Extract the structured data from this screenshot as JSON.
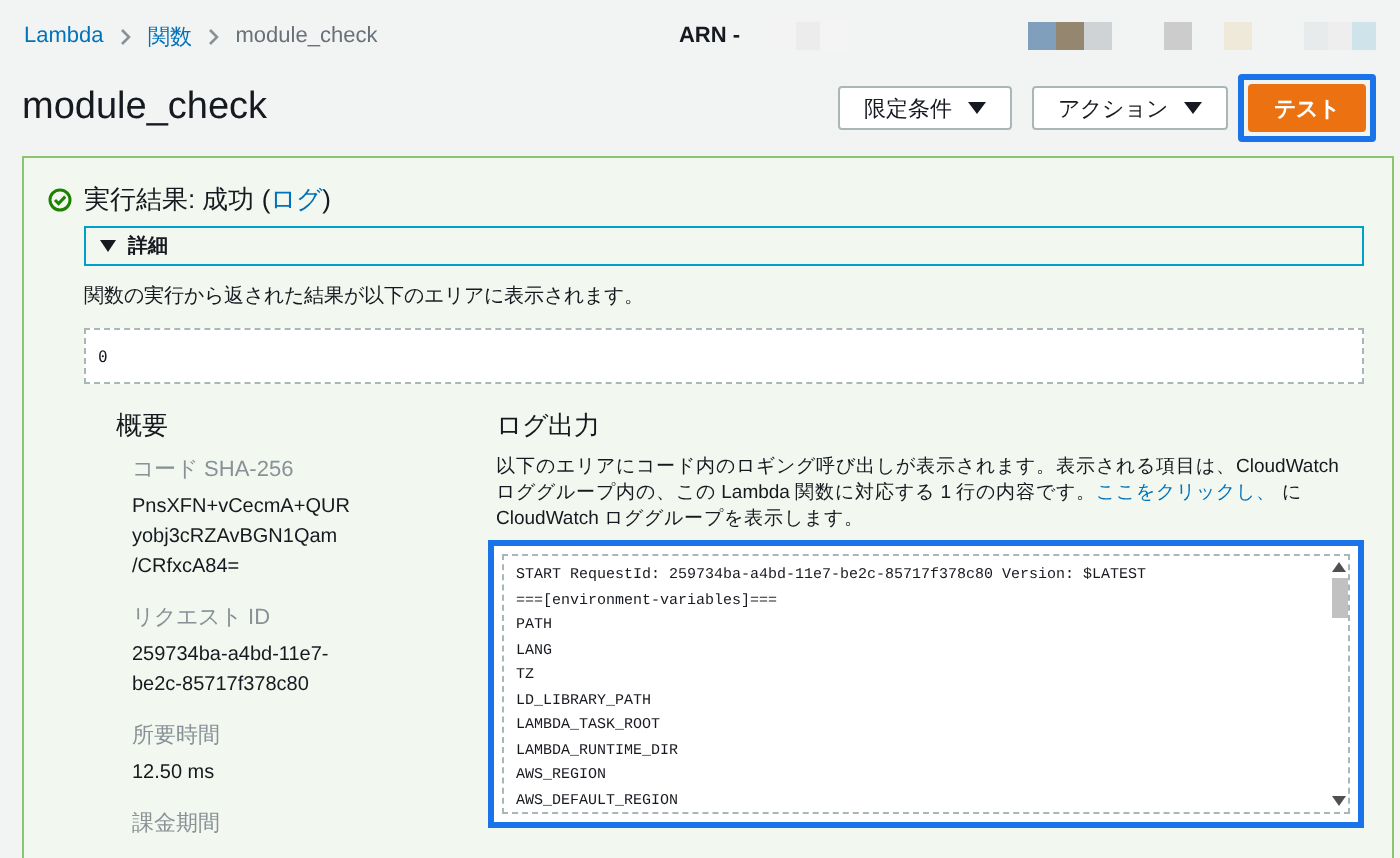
{
  "breadcrumb": [
    {
      "label": "Lambda",
      "link": true
    },
    {
      "label": "関数",
      "link": true
    },
    {
      "label": "module_check",
      "link": false
    }
  ],
  "arn": {
    "label": "ARN -"
  },
  "title": "module_check",
  "actions": [
    {
      "label": "限定条件",
      "kind": "dropdown",
      "highlighted": false
    },
    {
      "label": "アクション",
      "kind": "dropdown",
      "highlighted": false
    },
    {
      "label": "テスト",
      "kind": "primary",
      "highlighted": true
    }
  ],
  "result": {
    "succeeded": true,
    "heading": "実行結果: 成功 (",
    "log_link": "ログ",
    "heading_end": ")",
    "details": {
      "label": "詳細",
      "expanded": true
    },
    "description": "関数の実行から返された結果が以下のエリアに表示されます。",
    "output": "0"
  },
  "summary": {
    "title": "概要",
    "fields": [
      {
        "label": "コード SHA-256",
        "lines": [
          "PnsXFN+vCecmA+QUR",
          "yobj3cRZAvBGN1Qam",
          "/CRfxcA84="
        ]
      },
      {
        "label": "リクエスト ID",
        "lines": [
          "259734ba-a4bd-11e7-",
          "be2c-85717f378c80"
        ]
      },
      {
        "label": "所要時間",
        "lines": [
          "12.50 ms"
        ]
      },
      {
        "label": "課金期間"
      }
    ]
  },
  "log_output": {
    "title": "ログ出力",
    "description": "以下のエリアにコード内のロギング呼び出しが表示されます。表示される項目は、CloudWatch ロググループ内の、この Lambda 関数に対応する 1 行の内容です。",
    "link": "ここをクリックし、",
    "description_end": " に CloudWatch ロググループを表示します。",
    "highlighted": true,
    "lines": [
      "START RequestId: 259734ba-a4bd-11e7-be2c-85717f378c80 Version: $LATEST",
      "===[environment-variables]===",
      "PATH",
      "LANG",
      "TZ",
      "LD_LIBRARY_PATH",
      "LAMBDA_TASK_ROOT",
      "LAMBDA_RUNTIME_DIR",
      "AWS_REGION",
      "AWS_DEFAULT_REGION"
    ]
  }
}
